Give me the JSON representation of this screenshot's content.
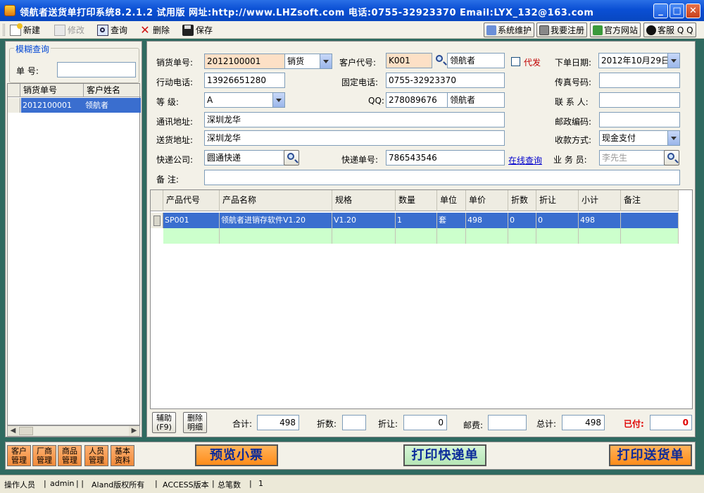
{
  "window": {
    "title": "领航者送货单打印系统8.2.1.2  试用版  网址:http://www.LHZsoft.com  电话:0755-32923370  Email:LYX_132@163.com"
  },
  "toolbar": {
    "new_label": "新建",
    "edit_label": "修改",
    "query_label": "查询",
    "delete_label": "删除",
    "save_label": "保存",
    "sysmaint_label": "系统维护",
    "register_label": "我要注册",
    "website_label": "官方网站",
    "support_label": "客服 Q Q"
  },
  "left": {
    "fuzzy_group": "模糊查询",
    "order_no_label": "单    号:",
    "order_no_value": "",
    "columns": [
      "销货单号",
      "客户姓名"
    ],
    "rows": [
      {
        "order": "2012100001",
        "customer": "领航者"
      }
    ]
  },
  "form": {
    "order_no_label": "销货单号:",
    "order_no": "2012100001",
    "order_type": "销货",
    "cust_code_label": "客户代号:",
    "cust_code": "K001",
    "cust_name": "领航者",
    "proxy_label": "代发",
    "order_date_label": "下单日期:",
    "order_date": "2012年10月29日",
    "mobile_label": "行动电话:",
    "mobile": "13926651280",
    "phone_label": "固定电话:",
    "phone": "0755-32923370",
    "fax_label": "传真号码:",
    "fax": "",
    "level_label": "等    级:",
    "level": "A",
    "qq_label": "QQ:",
    "qq": "278089676",
    "qq_name": "领航者",
    "contact_label": "联 系 人:",
    "contact": "",
    "address_label": "通讯地址:",
    "address": "深圳龙华",
    "zip_label": "邮政编码:",
    "zip": "",
    "ship_addr_label": "送货地址:",
    "ship_addr": "深圳龙华",
    "payment_label": "收款方式:",
    "payment": "现金支付",
    "courier_label": "快递公司:",
    "courier": "圆通快递",
    "tracking_label": "快递单号:",
    "tracking": "786543546",
    "online_query": "在线查询",
    "sales_label": "业 务 员:",
    "sales": "李先生",
    "remark_label": "备    注:",
    "remark": ""
  },
  "products": {
    "columns": [
      "产品代号",
      "产品名称",
      "规格",
      "数量",
      "单位",
      "单价",
      "折数",
      "折让",
      "小计",
      "备注"
    ],
    "rows": [
      {
        "code": "SP001",
        "name": "领航者进销存软件V1.20",
        "spec": "V1.20",
        "qty": "1",
        "unit": "套",
        "price": "498",
        "discount_rate": "0",
        "discount": "0",
        "subtotal": "498",
        "remark": ""
      }
    ]
  },
  "totals": {
    "aux_btn": "辅助(F9)",
    "del_detail_btn": "删除明细",
    "total_label": "合计:",
    "total": "498",
    "rate_label": "折数:",
    "rate": "",
    "discount_label": "折让:",
    "discount": "0",
    "postage_label": "邮费:",
    "postage": "",
    "grand_label": "总计:",
    "grand": "498",
    "paid_label": "已付:",
    "paid": "0"
  },
  "bottom": {
    "customer_mgmt": "客户管理",
    "vendor_mgmt": "厂商管理",
    "goods_mgmt": "商品管理",
    "staff_mgmt": "人员管理",
    "basic_data": "基本资料",
    "preview_receipt": "预览小票",
    "print_express": "打印快递单",
    "print_delivery": "打印送货单"
  },
  "status": {
    "operator_label": "操作人员",
    "operator": "admin",
    "copyright": "Aland版权所有",
    "version": "ACCESS版本",
    "count_label": "总笔数",
    "count": "1"
  }
}
